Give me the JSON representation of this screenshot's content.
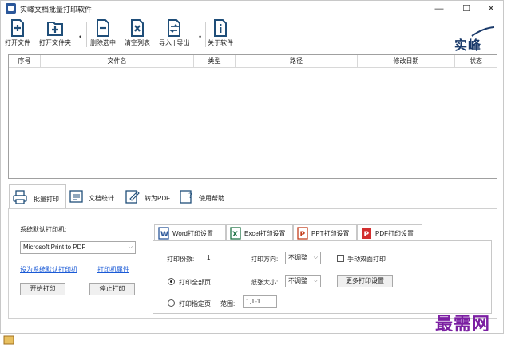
{
  "window": {
    "title": "实峰文档批量打印软件",
    "controls": {
      "minimize": "—",
      "maximize": "☐",
      "close": "✕"
    }
  },
  "toolbar": {
    "open_file": "打开文件",
    "open_folder": "打开文件夹",
    "delete_selected": "删除选中",
    "clear_list": "清空列表",
    "import_export": "导入 | 导出",
    "about": "关于软件",
    "dot": "•"
  },
  "logo": {
    "text": "实峰"
  },
  "file_table": {
    "columns": [
      "序号",
      "文件名",
      "类型",
      "路径",
      "修改日期",
      "状态"
    ],
    "rows": []
  },
  "main_tabs": [
    {
      "label": "批量打印",
      "active": true
    },
    {
      "label": "文档统计",
      "active": false
    },
    {
      "label": "转为PDF",
      "active": false
    },
    {
      "label": "使用帮助",
      "active": false
    }
  ],
  "printer": {
    "label": "系统默认打印机:",
    "selected": "Microsoft Print to PDF",
    "set_default_link": "设为系统默认打印机",
    "properties_link": "打印机属性",
    "start_button": "开始打印",
    "stop_button": "停止打印"
  },
  "settings_tabs": [
    {
      "label": "Word打印设置",
      "active": true,
      "color": "#2b579a",
      "letter": "W"
    },
    {
      "label": "Excel打印设置",
      "active": false,
      "color": "#217346",
      "letter": "X"
    },
    {
      "label": "PPT打印设置",
      "active": false,
      "color": "#c43e1c",
      "letter": "P"
    },
    {
      "label": "PDF打印设置",
      "active": false,
      "color": "#d32f2f",
      "letter": "P"
    }
  ],
  "word_settings": {
    "copies_label": "打印份数:",
    "copies_value": "1",
    "orientation_label": "打印方向:",
    "orientation_value": "不调整",
    "duplex_label": "手动双面打印",
    "all_pages_label": "打印全部页",
    "paper_size_label": "纸张大小:",
    "paper_size_value": "不调整",
    "more_settings_button": "更多打印设置",
    "specific_pages_label": "打印指定页",
    "range_label": "范围:",
    "range_value": "1,1-1"
  },
  "watermark": "最需网",
  "colors": {
    "accent": "#1a5ad6",
    "icon_blue": "#1f4e79",
    "watermark": "#7b1fa2"
  }
}
